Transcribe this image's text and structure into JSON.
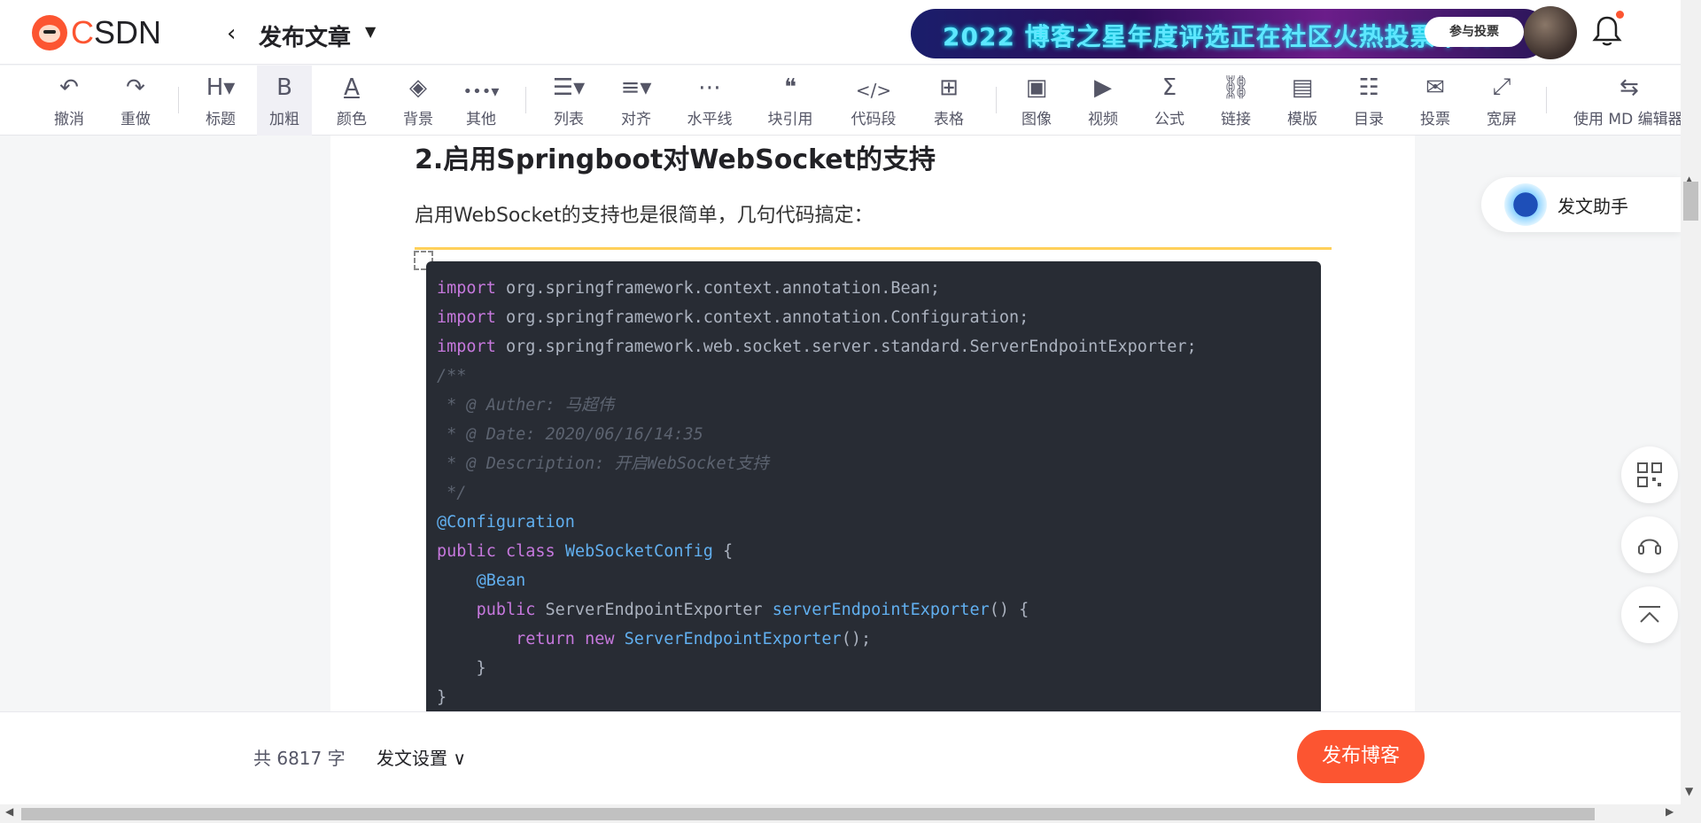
{
  "header": {
    "logo_text_c": "C",
    "logo_text_rest": "SDN",
    "back_icon": "chevron-left-icon",
    "title": "发布文章",
    "banner_text": "2022 博客之星年度评选正在社区火热投票中...",
    "banner_button": "参与投票"
  },
  "toolbar": {
    "items": [
      {
        "icon": "↶",
        "label": "撤消"
      },
      {
        "icon": "↷",
        "label": "重做"
      },
      {
        "icon": "H▾",
        "label": "标题"
      },
      {
        "icon": "B",
        "label": "加粗"
      },
      {
        "icon": "A",
        "label": "颜色"
      },
      {
        "icon": "◈",
        "label": "背景"
      },
      {
        "icon": "•••▾",
        "label": "其他"
      },
      {
        "icon": "☰▾",
        "label": "列表"
      },
      {
        "icon": "≡▾",
        "label": "对齐"
      },
      {
        "icon": "⋯",
        "label": "水平线"
      },
      {
        "icon": "❝",
        "label": "块引用"
      },
      {
        "icon": "</>",
        "label": "代码段"
      },
      {
        "icon": "⊞",
        "label": "表格"
      },
      {
        "icon": "▣",
        "label": "图像"
      },
      {
        "icon": "▶",
        "label": "视频"
      },
      {
        "icon": "Σ",
        "label": "公式"
      },
      {
        "icon": "⛓",
        "label": "链接"
      },
      {
        "icon": "▤",
        "label": "模版"
      },
      {
        "icon": "☷",
        "label": "目录"
      },
      {
        "icon": "✉",
        "label": "投票"
      },
      {
        "icon": "⤢",
        "label": "宽屏"
      },
      {
        "icon": "⇆",
        "label": "使用 MD 编辑器"
      }
    ]
  },
  "content": {
    "heading": "2.启用Springboot对WebSocket的支持",
    "paragraph": "启用WebSocket的支持也是很简单，几句代码搞定："
  },
  "assistant": {
    "label": "发文助手"
  },
  "bottom": {
    "wordcount": "共 6817 字",
    "settings": "发文设置",
    "publish": "发布博客"
  },
  "colors": {
    "brand": "#fc5531",
    "code_bg": "#282c34",
    "highlight_line": "#ffd05a"
  }
}
